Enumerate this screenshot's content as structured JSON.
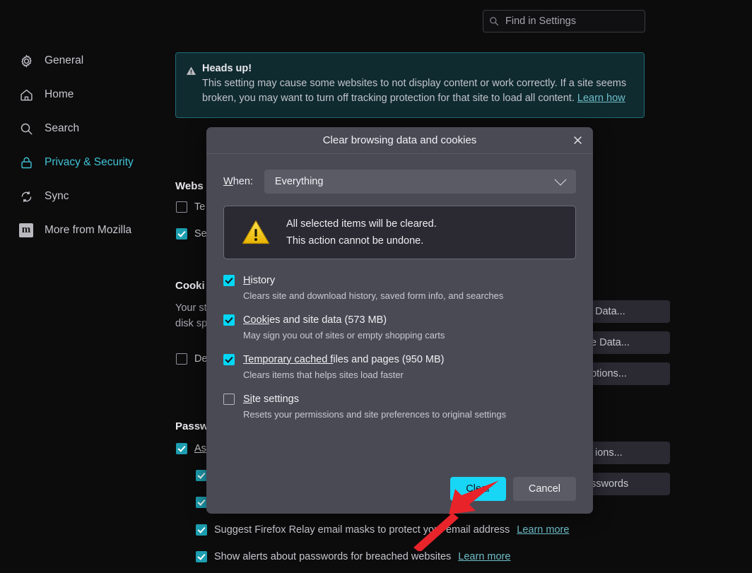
{
  "search": {
    "placeholder": "Find in Settings",
    "value": "",
    "icon": "search-icon"
  },
  "sidebar": {
    "items": [
      {
        "label": "General",
        "icon": "gear-icon",
        "active": false
      },
      {
        "label": "Home",
        "icon": "home-icon",
        "active": false
      },
      {
        "label": "Search",
        "icon": "search-icon",
        "active": false
      },
      {
        "label": "Privacy & Security",
        "icon": "lock-icon",
        "active": true
      },
      {
        "label": "Sync",
        "icon": "sync-icon",
        "active": false
      },
      {
        "label": "More from Mozilla",
        "icon": "mozilla-m-icon",
        "active": false
      }
    ]
  },
  "banner": {
    "icon": "warning-triangle-icon",
    "title": "Heads up!",
    "text": "This setting may cause some websites to not display content or work correctly. If a site seems broken, you may want to turn off tracking protection for that site to load all content.",
    "link": "Learn how"
  },
  "background": {
    "sections": [
      {
        "title": "Webs",
        "full_title": "Website Advertising Preferences"
      },
      {
        "title": "Cooki",
        "full_title": "Cookies and Site Data"
      },
      {
        "title": "Passw",
        "full_title": "Passwords"
      }
    ],
    "rows": [
      {
        "label": "Te",
        "checked": false
      },
      {
        "label": "Se",
        "checked": true
      },
      {
        "label": "De",
        "checked": false
      },
      {
        "label": "As",
        "checked": true,
        "underline": true
      },
      {
        "label": "",
        "checked": true
      },
      {
        "label": "",
        "checked": true
      },
      {
        "label": "Suggest Firefox Relay email masks to protect your email address",
        "checked": true,
        "link": "Learn more"
      },
      {
        "label": "Show alerts about passwords for breached websites",
        "checked": true,
        "link": "Learn more"
      }
    ],
    "description_lines": [
      "Your st",
      "disk sp"
    ],
    "buttons": [
      {
        "label": "Data..."
      },
      {
        "label": "e Data..."
      },
      {
        "label": "eptions..."
      },
      {
        "label": "ions..."
      },
      {
        "label": "sswords"
      }
    ]
  },
  "dialog": {
    "title": "Clear browsing data and cookies",
    "close_icon": "close-icon",
    "when": {
      "label_prefix": "W",
      "label_rest": "hen:",
      "selected": "Everything",
      "chevron_icon": "chevron-down-icon"
    },
    "alert": {
      "icon": "warning-triangle-icon",
      "line1": "All selected items will be cleared.",
      "line2": "This action cannot be undone."
    },
    "options": [
      {
        "accel": "H",
        "label_rest": "istory",
        "label": "History",
        "checked": true,
        "description": "Clears site and download history, saved form info, and searches"
      },
      {
        "accel": "Cooki",
        "label_rest": "es and site data (573 MB)",
        "label": "Cookies and site data (573 MB)",
        "checked": true,
        "description": "May sign you out of sites or empty shopping carts"
      },
      {
        "accel": "Temporary cached f",
        "label_rest": "iles and pages (950 MB)",
        "label": "Temporary cached files and pages (950 MB)",
        "checked": true,
        "description": "Clears items that helps sites load faster"
      },
      {
        "accel": "Si",
        "label_rest": "te settings",
        "label": "Site settings",
        "checked": false,
        "description": "Resets your permissions and site preferences to original settings"
      }
    ],
    "buttons": {
      "confirm": "Clear",
      "cancel": "Cancel"
    }
  },
  "annotation": {
    "arrow_color": "#e8232a",
    "target": "Clear"
  },
  "colors": {
    "page_bg": "#0c0c0d",
    "accent_teal": "#3fc3d4",
    "dialog_bg": "#4a4a55",
    "primary_button": "#18d6f5",
    "checkbox_on_dialog": "#00d7f5",
    "checkbox_on_page": "#1c9eb0",
    "banner_bg": "#0f2b30",
    "banner_border": "#1f6b73"
  }
}
